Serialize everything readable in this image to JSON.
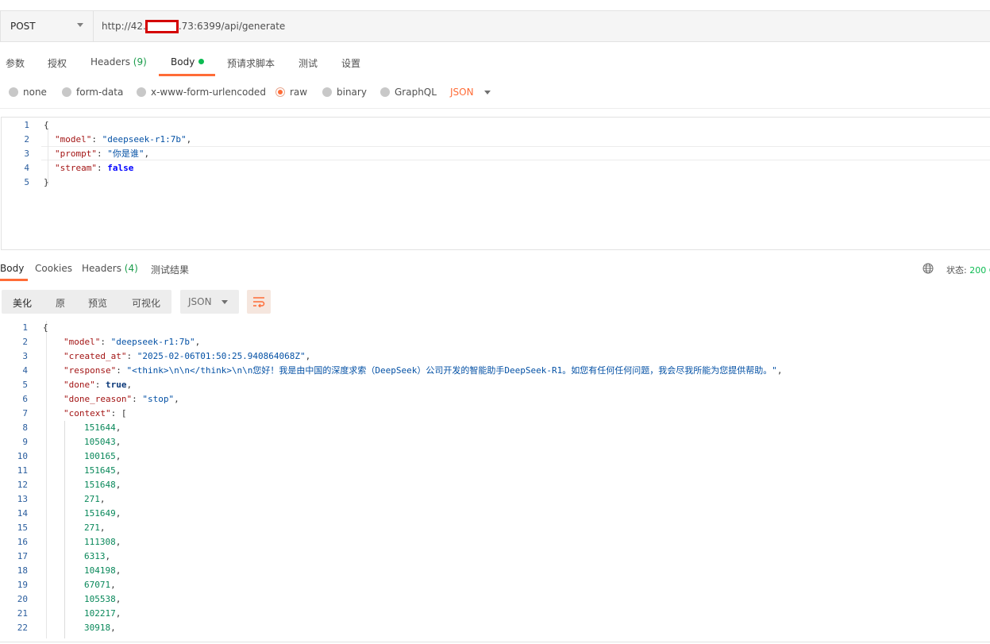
{
  "request": {
    "method": "POST",
    "url_prefix": "http://42.",
    "url_suffix": ".73:6399/api/generate"
  },
  "request_tabs": [
    {
      "label": "参数"
    },
    {
      "label": "授权"
    },
    {
      "label": "Headers",
      "count": "(9)"
    },
    {
      "label": "Body",
      "active": true
    },
    {
      "label": "预请求脚本"
    },
    {
      "label": "测试"
    },
    {
      "label": "设置"
    }
  ],
  "body_types": [
    {
      "label": "none"
    },
    {
      "label": "form-data"
    },
    {
      "label": "x-www-form-urlencoded"
    },
    {
      "label": "raw",
      "selected": true
    },
    {
      "label": "binary"
    },
    {
      "label": "GraphQL"
    }
  ],
  "body_format": "JSON",
  "request_body": {
    "lines": [
      {
        "n": "1",
        "t": "{"
      },
      {
        "n": "2",
        "k": "\"model\"",
        "v": "\"deepseek-r1:7b\"",
        "vt": "s",
        "tail": ","
      },
      {
        "n": "3",
        "k": "\"prompt\"",
        "v": "\"你是谁\"",
        "vt": "s",
        "tail": ","
      },
      {
        "n": "4",
        "k": "\"stream\"",
        "v": "false",
        "vt": "b",
        "tail": ""
      },
      {
        "n": "5",
        "t": "}"
      }
    ]
  },
  "response_tabs": [
    {
      "label": "Body",
      "active": true
    },
    {
      "label": "Cookies"
    },
    {
      "label": "Headers",
      "count": "(4)"
    },
    {
      "label": "测试结果"
    }
  ],
  "status": {
    "label": "状态:",
    "value": "200 O"
  },
  "view_modes": [
    {
      "label": "美化",
      "active": true
    },
    {
      "label": "原"
    },
    {
      "label": "预览"
    },
    {
      "label": "可视化"
    }
  ],
  "response_format": "JSON",
  "response_body": {
    "lines": [
      {
        "n": "1",
        "t": "{"
      },
      {
        "n": "2",
        "k": "\"model\"",
        "v": "\"deepseek-r1:7b\"",
        "vt": "s",
        "tail": ","
      },
      {
        "n": "3",
        "k": "\"created_at\"",
        "v": "\"2025-02-06T01:50:25.940864068Z\"",
        "vt": "s",
        "tail": ","
      },
      {
        "n": "4",
        "k": "\"response\"",
        "v": "\"<think>\\n\\n</think>\\n\\n您好！我是由中国的深度求索（DeepSeek）公司开发的智能助手DeepSeek-R1。如您有任何任何问题，我会尽我所能为您提供帮助。\"",
        "vt": "s",
        "tail": ","
      },
      {
        "n": "5",
        "k": "\"done\"",
        "v": "true",
        "vt": "b",
        "tail": ","
      },
      {
        "n": "6",
        "k": "\"done_reason\"",
        "v": "\"stop\"",
        "vt": "s",
        "tail": ","
      },
      {
        "n": "7",
        "k": "\"context\"",
        "v": "[",
        "vt": "p",
        "tail": ""
      },
      {
        "n": "8",
        "num": "151644"
      },
      {
        "n": "9",
        "num": "105043"
      },
      {
        "n": "10",
        "num": "100165"
      },
      {
        "n": "11",
        "num": "151645"
      },
      {
        "n": "12",
        "num": "151648"
      },
      {
        "n": "13",
        "num": "271"
      },
      {
        "n": "14",
        "num": "151649"
      },
      {
        "n": "15",
        "num": "271"
      },
      {
        "n": "16",
        "num": "111308"
      },
      {
        "n": "17",
        "num": "6313"
      },
      {
        "n": "18",
        "num": "104198"
      },
      {
        "n": "19",
        "num": "67071"
      },
      {
        "n": "20",
        "num": "105538"
      },
      {
        "n": "21",
        "num": "102217"
      },
      {
        "n": "22",
        "num": "30918"
      }
    ]
  }
}
